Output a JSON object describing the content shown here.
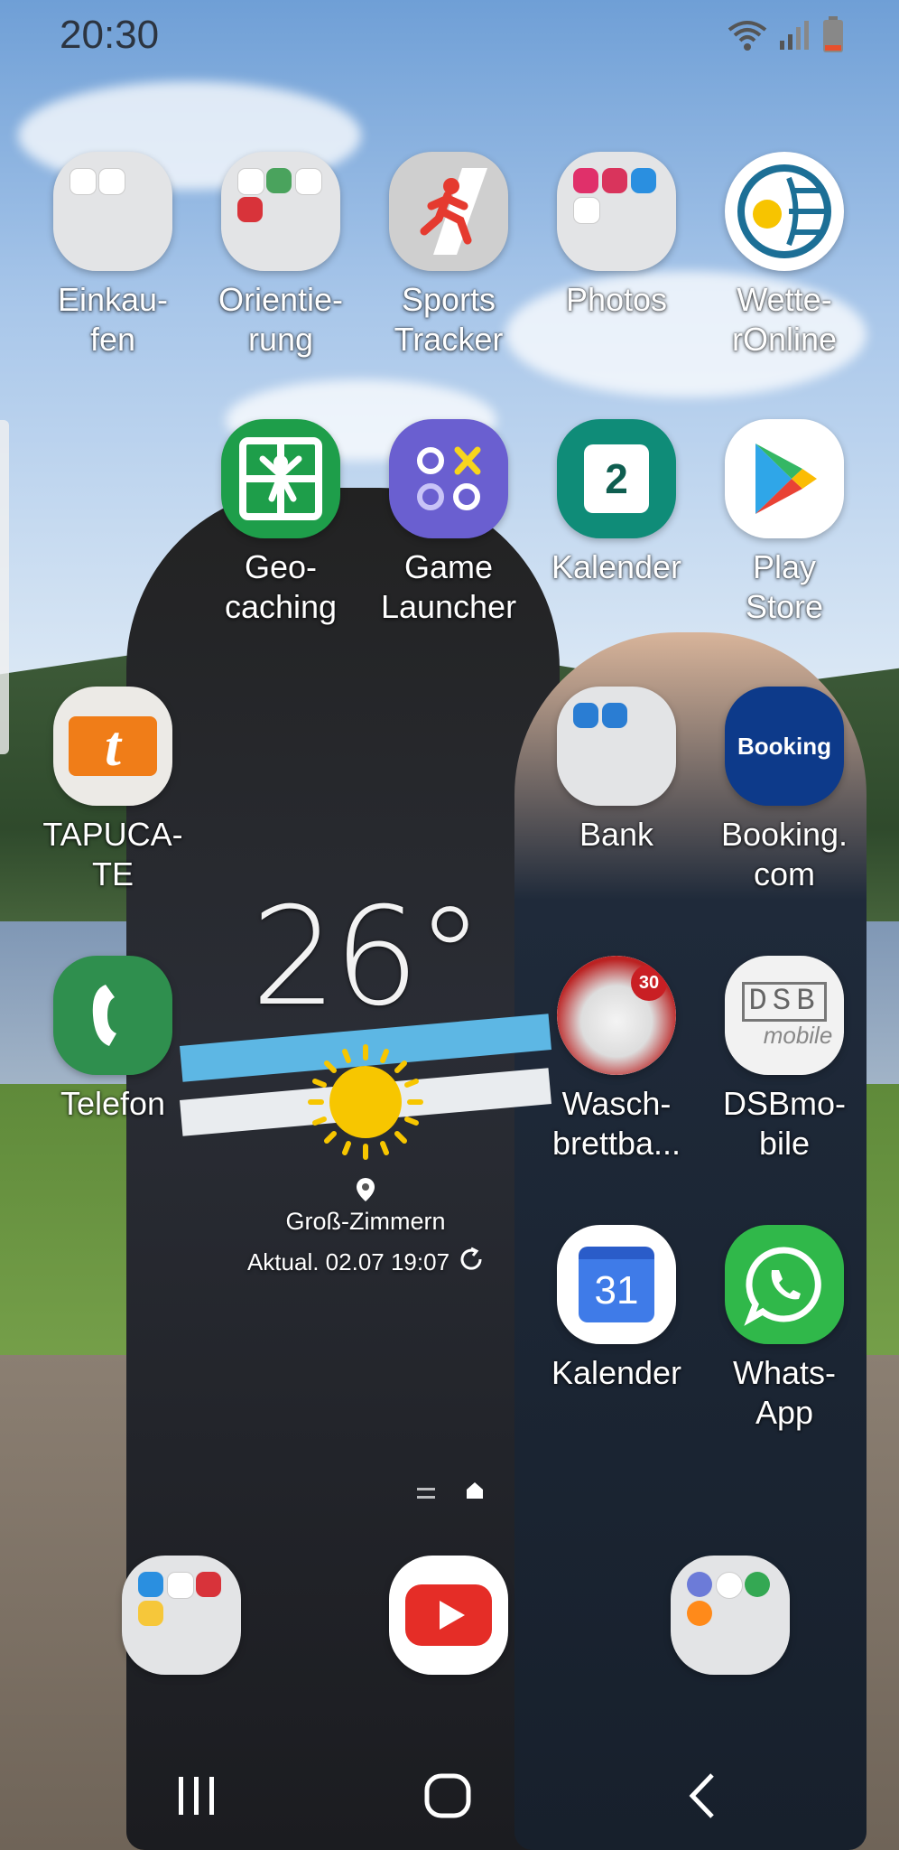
{
  "status_bar": {
    "time": "20:30",
    "icons": [
      "wifi-icon",
      "signal-icon",
      "battery-icon"
    ]
  },
  "apps": {
    "einkaufen": {
      "label": "Einkau-\nfen",
      "type": "folder"
    },
    "orientierung": {
      "label": "Orientie-\nrung",
      "type": "folder"
    },
    "sports_tracker": {
      "label": "Sports\nTracker"
    },
    "photos": {
      "label": "Photos",
      "type": "folder"
    },
    "wetteronline": {
      "label": "Wette-\nrOnline"
    },
    "geocaching": {
      "label": "Geo-\ncaching"
    },
    "game_launcher": {
      "label": "Game\nLauncher"
    },
    "kalender_samsung": {
      "label": "Kalender",
      "icon_text": "2"
    },
    "play_store": {
      "label": "Play\nStore"
    },
    "tapucate": {
      "label": "TAPUCA-\nTE",
      "icon_text": "t"
    },
    "bank": {
      "label": "Bank",
      "type": "folder"
    },
    "booking": {
      "label": "Booking.\ncom",
      "icon_text": "Booking"
    },
    "telefon": {
      "label": "Telefon"
    },
    "waschbrettbauch": {
      "label": "Wasch-\nbrettba...",
      "icon_text": "30"
    },
    "dsbmobile": {
      "label": "DSBmo-\nbile",
      "icon_text_top": "DSB",
      "icon_text_bottom": "mobile"
    },
    "kalender_google": {
      "label": "Kalender",
      "icon_text": "31"
    },
    "whatsapp": {
      "label": "Whats-\nApp"
    }
  },
  "weather_widget": {
    "temperature": "26°",
    "icon": "sun-icon",
    "location": "Groß-Zimmern",
    "updated": "Aktual. 02.07 19:07"
  },
  "dock": [
    "messages-folder",
    "youtube",
    "browser-folder"
  ],
  "nav_bar": [
    "recents-button",
    "home-button",
    "back-button"
  ],
  "colors": {
    "label_text": "#ffffff",
    "folder_bg": "#e3e4e6",
    "geocaching_green": "#1e9e4a",
    "game_launcher_purple": "#6a5fd0",
    "kalender_teal": "#0f8c78",
    "booking_blue": "#0d3a8a",
    "telefon_green": "#2f8f4e",
    "whatsapp_green": "#30b84a",
    "youtube_red": "#e52d27",
    "tapucate_orange": "#f07d18"
  }
}
